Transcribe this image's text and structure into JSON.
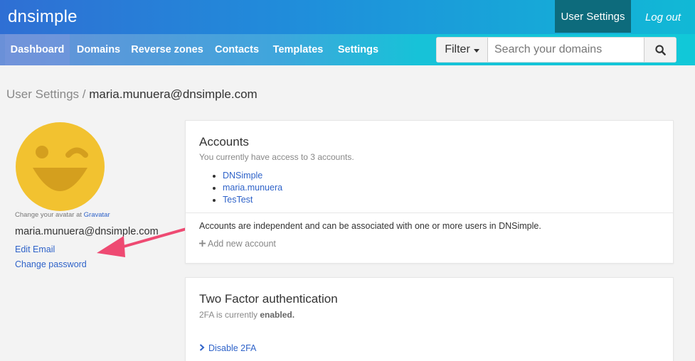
{
  "header": {
    "logo": "dnsimple",
    "user_settings_label": "User Settings",
    "logout_label": "Log out"
  },
  "nav": {
    "tabs": [
      {
        "label": "Dashboard",
        "active": true
      },
      {
        "label": "Domains"
      },
      {
        "label": "Reverse zones"
      },
      {
        "label": "Contacts"
      },
      {
        "label": "Templates"
      },
      {
        "label": "Settings"
      }
    ],
    "filter_label": "Filter",
    "search_placeholder": "Search your domains"
  },
  "breadcrumb": {
    "parent": "User Settings /",
    "current": "maria.munuera@dnsimple.com"
  },
  "profile": {
    "avatar_caption": "Change your avatar at",
    "gravatar_link": "Gravatar",
    "email": "maria.munuera@dnsimple.com",
    "edit_email_label": "Edit Email",
    "change_password_label": "Change password"
  },
  "accounts_panel": {
    "title": "Accounts",
    "subtitle": "You currently have access to 3 accounts.",
    "accounts": [
      "DNSimple",
      "maria.munuera",
      "TesTest"
    ],
    "note": "Accounts are independent and can be associated with one or more users in DNSimple.",
    "add_account_label": "Add new account"
  },
  "twofa_panel": {
    "title": "Two Factor authentication",
    "status_prefix": "2FA is currently",
    "status_value": "enabled.",
    "disable_label": "Disable 2FA"
  },
  "colors": {
    "link": "#2f63c9",
    "annotation_arrow": "#ee4a72",
    "avatar": "#f2c230"
  },
  "icons": {
    "filter_caret": "caret-down-icon",
    "search": "search-icon",
    "add": "plus-icon",
    "disable": "chevron-right-icon",
    "avatar": "winking-smiley-icon",
    "annotation": "arrow-annotation-icon"
  }
}
